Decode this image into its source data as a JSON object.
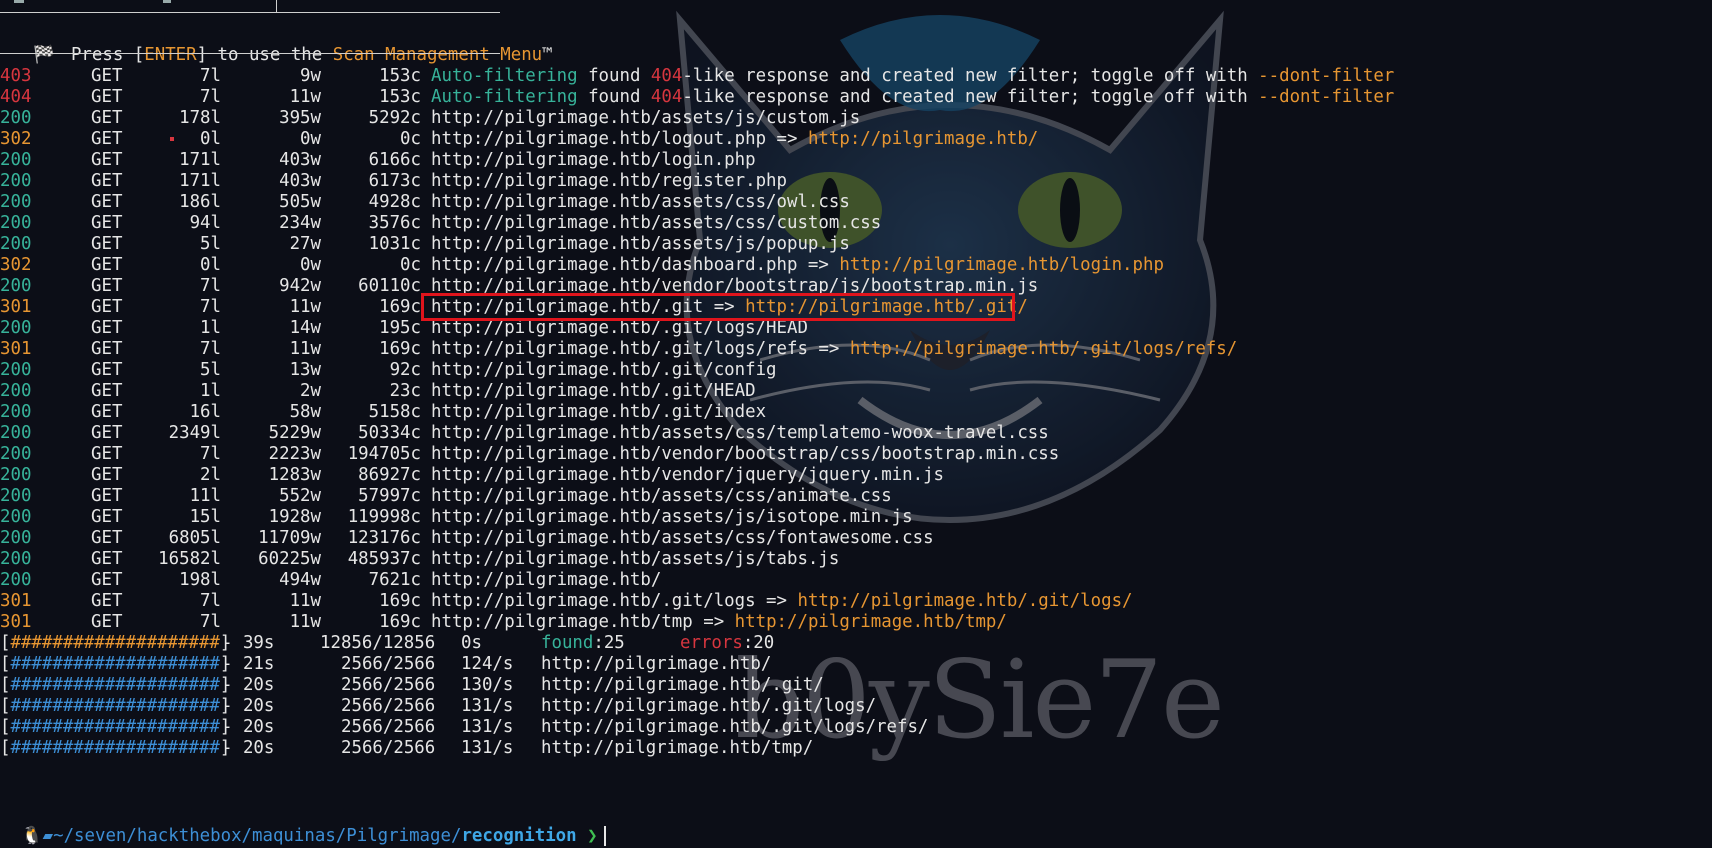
{
  "banner": {
    "icon": "checkered-flag-icon",
    "text_prefix": "Press [",
    "enter_key": "ENTER",
    "text_mid": "] to use the ",
    "menu_name": "Scan Management Menu",
    "tm": "™"
  },
  "results": [
    {
      "status": "403",
      "method": "GET",
      "lines": "7l",
      "words": "9w",
      "chars": "153c",
      "url": "",
      "redirect": "",
      "note_prefix": "Auto-filtering",
      "note_mid": " found ",
      "note_code": "404",
      "note_rest": "-like response and created new filter; toggle off with ",
      "note_flag": "--dont-filter"
    },
    {
      "status": "404",
      "method": "GET",
      "lines": "7l",
      "words": "11w",
      "chars": "153c",
      "url": "",
      "redirect": "",
      "note_prefix": "Auto-filtering",
      "note_mid": " found ",
      "note_code": "404",
      "note_rest": "-like response and created new filter; toggle off with ",
      "note_flag": "--dont-filter"
    },
    {
      "status": "200",
      "method": "GET",
      "lines": "178l",
      "words": "395w",
      "chars": "5292c",
      "url": "http://pilgrimage.htb/assets/js/custom.js",
      "redirect": ""
    },
    {
      "status": "302",
      "method": "GET",
      "lines": "0l",
      "words": "0w",
      "chars": "0c",
      "url": "http://pilgrimage.htb/logout.php",
      "redirect": "http://pilgrimage.htb/"
    },
    {
      "status": "200",
      "method": "GET",
      "lines": "171l",
      "words": "403w",
      "chars": "6166c",
      "url": "http://pilgrimage.htb/login.php",
      "redirect": ""
    },
    {
      "status": "200",
      "method": "GET",
      "lines": "171l",
      "words": "403w",
      "chars": "6173c",
      "url": "http://pilgrimage.htb/register.php",
      "redirect": ""
    },
    {
      "status": "200",
      "method": "GET",
      "lines": "186l",
      "words": "505w",
      "chars": "4928c",
      "url": "http://pilgrimage.htb/assets/css/owl.css",
      "redirect": ""
    },
    {
      "status": "200",
      "method": "GET",
      "lines": "94l",
      "words": "234w",
      "chars": "3576c",
      "url": "http://pilgrimage.htb/assets/css/custom.css",
      "redirect": ""
    },
    {
      "status": "200",
      "method": "GET",
      "lines": "5l",
      "words": "27w",
      "chars": "1031c",
      "url": "http://pilgrimage.htb/assets/js/popup.js",
      "redirect": ""
    },
    {
      "status": "302",
      "method": "GET",
      "lines": "0l",
      "words": "0w",
      "chars": "0c",
      "url": "http://pilgrimage.htb/dashboard.php",
      "redirect": "http://pilgrimage.htb/login.php"
    },
    {
      "status": "200",
      "method": "GET",
      "lines": "7l",
      "words": "942w",
      "chars": "60110c",
      "url": "http://pilgrimage.htb/vendor/bootstrap/js/bootstrap.min.js",
      "redirect": ""
    },
    {
      "status": "301",
      "method": "GET",
      "lines": "7l",
      "words": "11w",
      "chars": "169c",
      "url": "http://pilgrimage.htb/.git",
      "redirect": "http://pilgrimage.htb/.git/"
    },
    {
      "status": "200",
      "method": "GET",
      "lines": "1l",
      "words": "14w",
      "chars": "195c",
      "url": "http://pilgrimage.htb/.git/logs/HEAD",
      "redirect": ""
    },
    {
      "status": "301",
      "method": "GET",
      "lines": "7l",
      "words": "11w",
      "chars": "169c",
      "url": "http://pilgrimage.htb/.git/logs/refs",
      "redirect": "http://pilgrimage.htb/.git/logs/refs/"
    },
    {
      "status": "200",
      "method": "GET",
      "lines": "5l",
      "words": "13w",
      "chars": "92c",
      "url": "http://pilgrimage.htb/.git/config",
      "redirect": ""
    },
    {
      "status": "200",
      "method": "GET",
      "lines": "1l",
      "words": "2w",
      "chars": "23c",
      "url": "http://pilgrimage.htb/.git/HEAD",
      "redirect": ""
    },
    {
      "status": "200",
      "method": "GET",
      "lines": "16l",
      "words": "58w",
      "chars": "5158c",
      "url": "http://pilgrimage.htb/.git/index",
      "redirect": ""
    },
    {
      "status": "200",
      "method": "GET",
      "lines": "2349l",
      "words": "5229w",
      "chars": "50334c",
      "url": "http://pilgrimage.htb/assets/css/templatemo-woox-travel.css",
      "redirect": ""
    },
    {
      "status": "200",
      "method": "GET",
      "lines": "7l",
      "words": "2223w",
      "chars": "194705c",
      "url": "http://pilgrimage.htb/vendor/bootstrap/css/bootstrap.min.css",
      "redirect": ""
    },
    {
      "status": "200",
      "method": "GET",
      "lines": "2l",
      "words": "1283w",
      "chars": "86927c",
      "url": "http://pilgrimage.htb/vendor/jquery/jquery.min.js",
      "redirect": ""
    },
    {
      "status": "200",
      "method": "GET",
      "lines": "11l",
      "words": "552w",
      "chars": "57997c",
      "url": "http://pilgrimage.htb/assets/css/animate.css",
      "redirect": ""
    },
    {
      "status": "200",
      "method": "GET",
      "lines": "15l",
      "words": "1928w",
      "chars": "119998c",
      "url": "http://pilgrimage.htb/assets/js/isotope.min.js",
      "redirect": ""
    },
    {
      "status": "200",
      "method": "GET",
      "lines": "6805l",
      "words": "11709w",
      "chars": "123176c",
      "url": "http://pilgrimage.htb/assets/css/fontawesome.css",
      "redirect": ""
    },
    {
      "status": "200",
      "method": "GET",
      "lines": "16582l",
      "words": "60225w",
      "chars": "485937c",
      "url": "http://pilgrimage.htb/assets/js/tabs.js",
      "redirect": ""
    },
    {
      "status": "200",
      "method": "GET",
      "lines": "198l",
      "words": "494w",
      "chars": "7621c",
      "url": "http://pilgrimage.htb/",
      "redirect": ""
    },
    {
      "status": "301",
      "method": "GET",
      "lines": "7l",
      "words": "11w",
      "chars": "169c",
      "url": "http://pilgrimage.htb/.git/logs",
      "redirect": "http://pilgrimage.htb/.git/logs/"
    },
    {
      "status": "301",
      "method": "GET",
      "lines": "7l",
      "words": "11w",
      "chars": "169c",
      "url": "http://pilgrimage.htb/tmp",
      "redirect": "http://pilgrimage.htb/tmp/"
    }
  ],
  "progress_summary": {
    "bar": "[####################]",
    "time": "- 39s",
    "count": "12856/12856",
    "rate": "0s",
    "found_label": "found",
    "found_value": ":25",
    "errors_label": "errors",
    "errors_value": ":20"
  },
  "progress_rows": [
    {
      "bar": "[####################]",
      "time": "- 21s",
      "count": "2566/2566",
      "rate": "124/s",
      "url": "http://pilgrimage.htb/"
    },
    {
      "bar": "[####################]",
      "time": "- 20s",
      "count": "2566/2566",
      "rate": "130/s",
      "url": "http://pilgrimage.htb/.git/"
    },
    {
      "bar": "[####################]",
      "time": "- 20s",
      "count": "2566/2566",
      "rate": "131/s",
      "url": "http://pilgrimage.htb/.git/logs/"
    },
    {
      "bar": "[####################]",
      "time": "- 20s",
      "count": "2566/2566",
      "rate": "131/s",
      "url": "http://pilgrimage.htb/.git/logs/refs/"
    },
    {
      "bar": "[####################]",
      "time": "- 20s",
      "count": "2566/2566",
      "rate": "131/s",
      "url": "http://pilgrimage.htb/tmp/"
    }
  ],
  "prompt": {
    "os_icon": "linux-penguin-icon",
    "folder_icon": "folder-icon",
    "path": "~/seven/hackthebox/maquinas/Pilgrimage/",
    "leaf": "recognition",
    "chevron": "❯"
  },
  "watermark_text": "b0ySie7e",
  "colors": {
    "background": "#0c0e17",
    "status_200": "#37b39a",
    "status_3xx": "#e79632",
    "status_4xx": "#d7363f",
    "highlight_box": "#e0141c"
  }
}
